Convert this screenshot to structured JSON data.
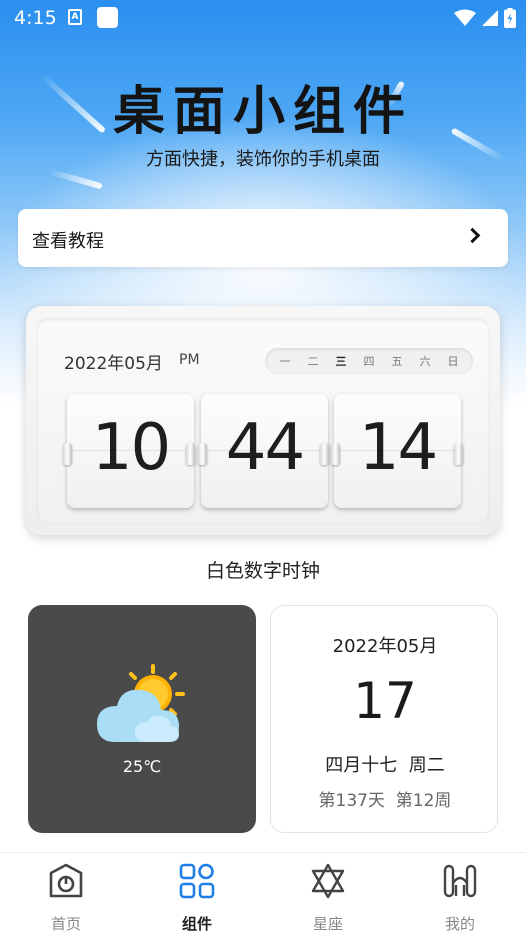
{
  "status_bar": {
    "time": "4:15",
    "notification_icons": [
      "a-icon",
      "app-icon"
    ],
    "system_icons": [
      "wifi-icon",
      "signal-icon",
      "battery-icon"
    ]
  },
  "hero": {
    "title": "桌面小组件",
    "subtitle": "方面快捷，装饰你的手机桌面"
  },
  "tutorial": {
    "label": "查看教程",
    "icon": "chevron-right-icon"
  },
  "clock_widget": {
    "date": "2022年05月",
    "ampm": "PM",
    "weekdays": [
      "一",
      "二",
      "三",
      "四",
      "五",
      "六",
      "日"
    ],
    "active_weekday": "三",
    "hours": "10",
    "minutes": "44",
    "seconds": "14",
    "caption": "白色数字时钟"
  },
  "weather_widget": {
    "icon": "partly-cloudy-icon",
    "temperature": "25℃"
  },
  "calendar_widget": {
    "month": "2022年05月",
    "day": "17",
    "lunar": "四月十七  周二",
    "week_info": "第137天  第12周"
  },
  "bottom_nav": {
    "items": [
      {
        "label": "首页",
        "icon": "home-icon",
        "active": false
      },
      {
        "label": "组件",
        "icon": "widgets-grid-icon",
        "active": true
      },
      {
        "label": "星座",
        "icon": "star-of-david-icon",
        "active": false
      },
      {
        "label": "我的",
        "icon": "profile-icon",
        "active": false
      }
    ]
  },
  "colors": {
    "accent": "#1f7fe6",
    "hero_blue": "#2a8ff0",
    "weather_card_bg": "#4a4a4a"
  }
}
